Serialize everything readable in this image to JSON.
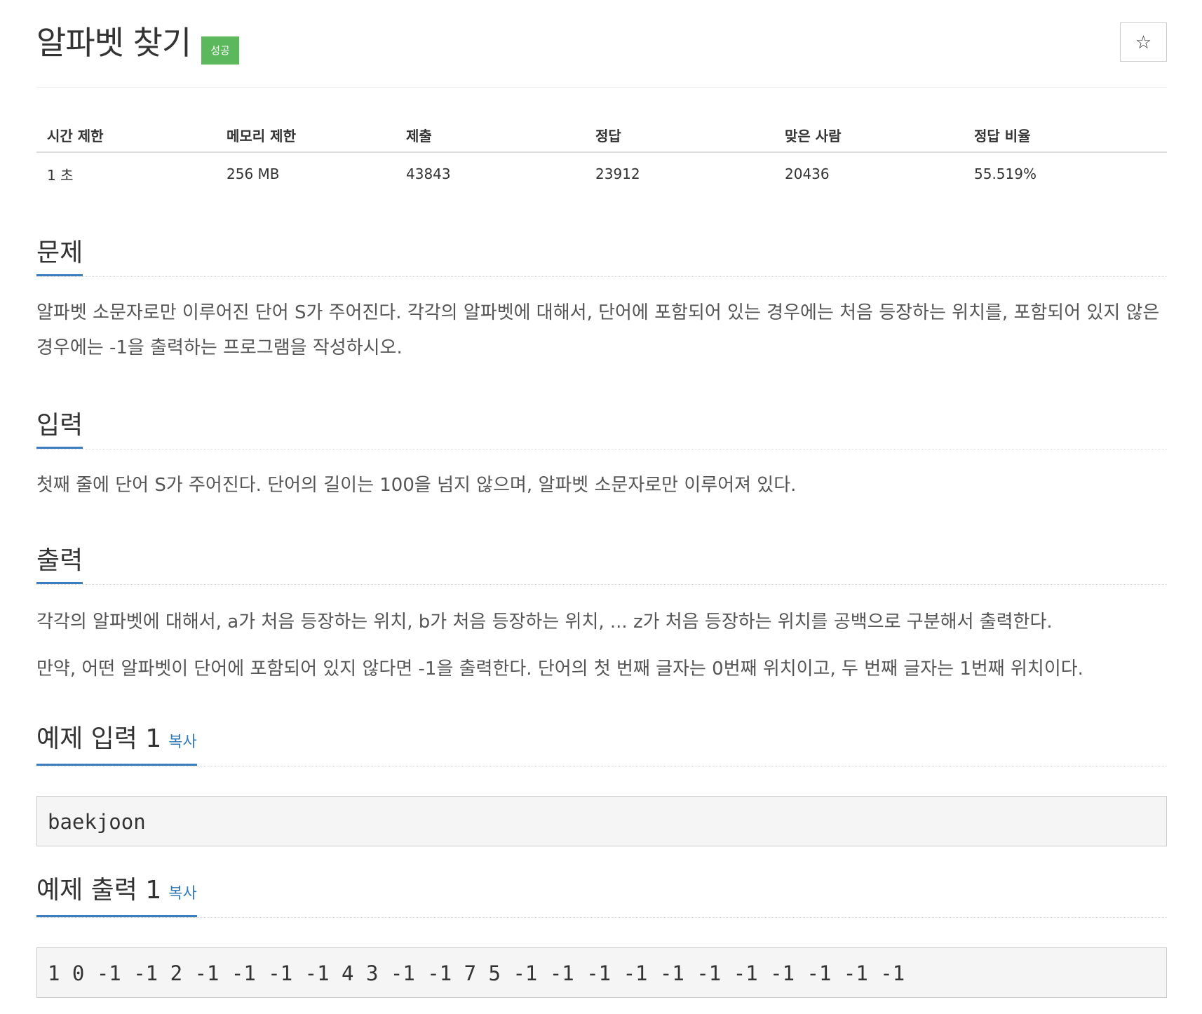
{
  "header": {
    "title": "알파벳 찾기",
    "status_badge": "성공",
    "star_icon": "☆"
  },
  "stats": {
    "headers": [
      "시간 제한",
      "메모리 제한",
      "제출",
      "정답",
      "맞은 사람",
      "정답 비율"
    ],
    "values": [
      "1 초",
      "256 MB",
      "43843",
      "23912",
      "20436",
      "55.519%"
    ]
  },
  "problem": {
    "heading": "문제",
    "text": "알파벳 소문자로만 이루어진 단어 S가 주어진다. 각각의 알파벳에 대해서, 단어에 포함되어 있는 경우에는 처음 등장하는 위치를, 포함되어 있지 않은 경우에는 -1을 출력하는 프로그램을 작성하시오."
  },
  "input": {
    "heading": "입력",
    "text": "첫째 줄에 단어 S가 주어진다. 단어의 길이는 100을 넘지 않으며, 알파벳 소문자로만 이루어져 있다."
  },
  "output": {
    "heading": "출력",
    "text1": "각각의 알파벳에 대해서, a가 처음 등장하는 위치, b가 처음 등장하는 위치, ... z가 처음 등장하는 위치를 공백으로 구분해서 출력한다.",
    "text2": "만약, 어떤 알파벳이 단어에 포함되어 있지 않다면 -1을 출력한다. 단어의 첫 번째 글자는 0번째 위치이고, 두 번째 글자는 1번째 위치이다."
  },
  "sample_input": {
    "heading": "예제 입력 1",
    "copy_label": "복사",
    "content": "baekjoon"
  },
  "sample_output": {
    "heading": "예제 출력 1",
    "copy_label": "복사",
    "content": "1 0 -1 -1 2 -1 -1 -1 -1 4 3 -1 -1 7 5 -1 -1 -1 -1 -1 -1 -1 -1 -1 -1 -1"
  },
  "colors": {
    "badge": "#5cb85c",
    "heading_underline": "#3b7dbf",
    "link": "#337ab7"
  }
}
